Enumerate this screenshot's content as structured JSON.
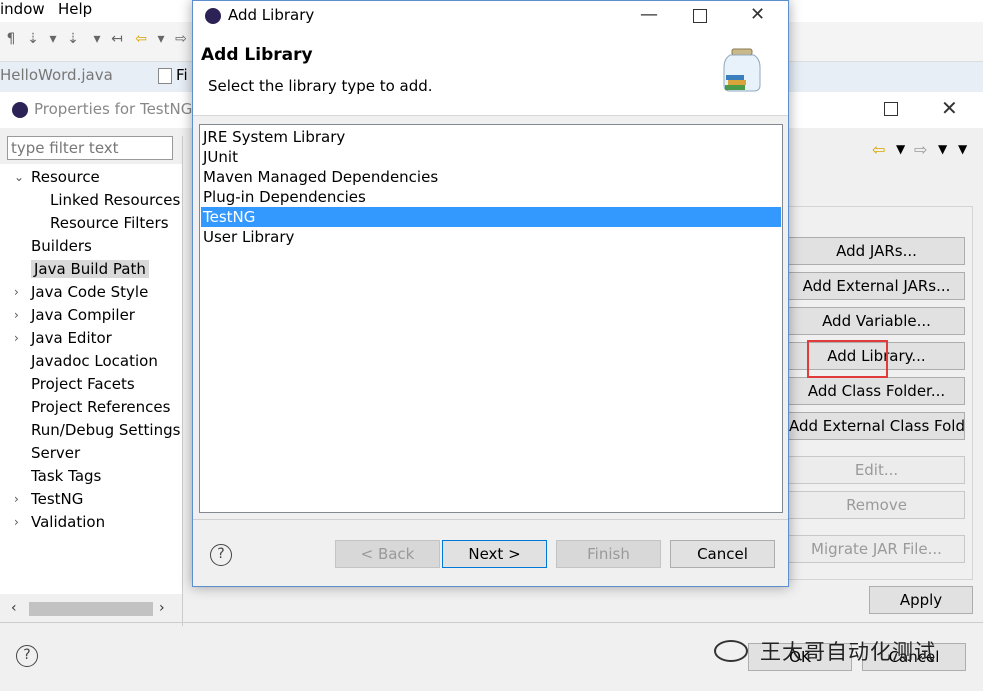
{
  "menubar": {
    "items": [
      "indow",
      "Help"
    ]
  },
  "editor_tabs": [
    "HelloWord.java",
    "Fi"
  ],
  "properties": {
    "title": "Properties for TestNG",
    "filter_placeholder": "type filter text",
    "tree": [
      {
        "label": "Resource",
        "arrow": "v"
      },
      {
        "label": "Linked Resources"
      },
      {
        "label": "Resource Filters"
      },
      {
        "label": "Builders"
      },
      {
        "label": "Java Build Path",
        "selected": true
      },
      {
        "label": "Java Code Style",
        "arrow": ">"
      },
      {
        "label": "Java Compiler",
        "arrow": ">"
      },
      {
        "label": "Java Editor",
        "arrow": ">"
      },
      {
        "label": "Javadoc Location"
      },
      {
        "label": "Project Facets"
      },
      {
        "label": "Project References"
      },
      {
        "label": "Run/Debug Settings"
      },
      {
        "label": "Server"
      },
      {
        "label": "Task Tags"
      },
      {
        "label": "TestNG",
        "arrow": ">"
      },
      {
        "label": "Validation",
        "arrow": ">"
      }
    ],
    "buttons": {
      "add_jars": "Add JARs...",
      "add_external_jars": "Add External JARs...",
      "add_variable": "Add Variable...",
      "add_library": "Add Library...",
      "add_class_folder": "Add Class Folder...",
      "add_external_class_folder": "Add External Class Folder...",
      "edit": "Edit...",
      "remove": "Remove",
      "migrate_jar": "Migrate JAR File...",
      "apply": "Apply",
      "ok": "OK",
      "cancel": "Cancel"
    }
  },
  "dialog": {
    "title": "Add Library",
    "heading": "Add Library",
    "subtitle": "Select the library type to add.",
    "libraries": [
      "JRE System Library",
      "JUnit",
      "Maven Managed Dependencies",
      "Plug-in Dependencies",
      "TestNG",
      "User Library"
    ],
    "selected_library": "TestNG",
    "buttons": {
      "back": "< Back",
      "next": "Next >",
      "finish": "Finish",
      "cancel": "Cancel"
    }
  },
  "watermark": "王大哥自动化测试",
  "colors": {
    "selection": "#3399ff",
    "highlight_box": "#e03c3c",
    "default_button_border": "#0078d7"
  }
}
